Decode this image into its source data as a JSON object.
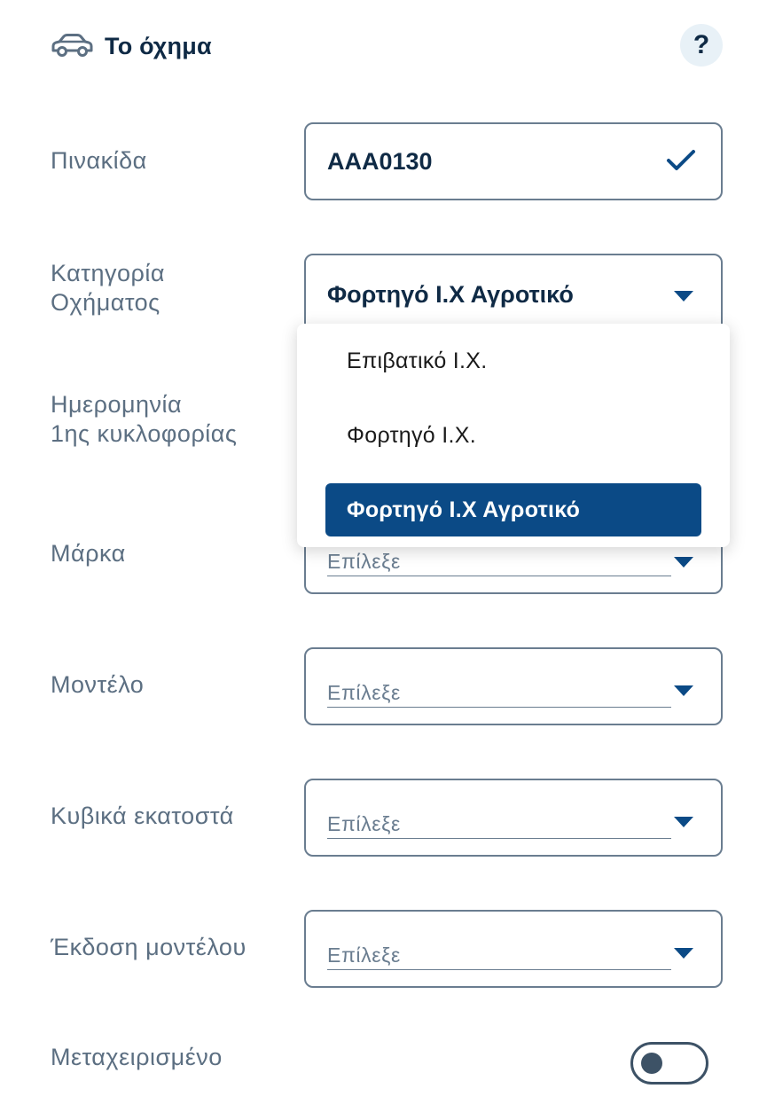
{
  "header": {
    "title": "Το όχημα",
    "car_icon": "car-icon",
    "help_label": "?"
  },
  "fields": {
    "plate": {
      "label": "Πινακίδα",
      "value": "AAA0130"
    },
    "category": {
      "label_line1": "Κατηγορία",
      "label_line2": "Οχήματος",
      "value": "Φορτηγό Ι.Χ Αγροτικό"
    },
    "first_registration": {
      "label_line1": "Ημερομηνία",
      "label_line2": "1ης κυκλοφορίας"
    },
    "brand": {
      "label": "Μάρκα",
      "placeholder": "Επίλεξε"
    },
    "model": {
      "label": "Μοντέλο",
      "placeholder": "Επίλεξε"
    },
    "cc": {
      "label": "Κυβικά εκατοστά",
      "placeholder": "Επίλεξε"
    },
    "version": {
      "label": "Έκδοση μοντέλου",
      "placeholder": "Επίλεξε"
    },
    "used": {
      "label": "Μεταχειρισμένο",
      "toggle_on": false
    }
  },
  "dropdown": {
    "options": [
      "Επιβατικό Ι.Χ.",
      "Φορτηγό Ι.Χ.",
      "Φορτηγό Ι.Χ Αγροτικό"
    ],
    "selected_index": 2
  },
  "colors": {
    "accent": "#0b4a86",
    "title": "#0f2a45",
    "label": "#5c6f82",
    "border": "#6a7d90",
    "help_bg": "#e8f1f7"
  }
}
